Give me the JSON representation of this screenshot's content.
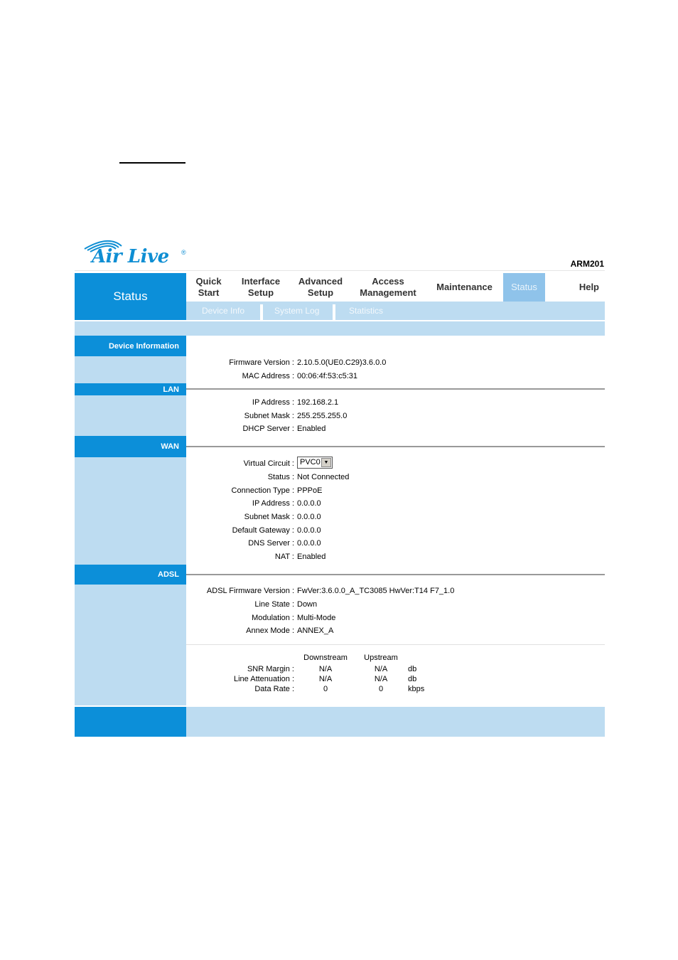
{
  "brand": {
    "logo_text": "Air Live",
    "registered": "®",
    "model": "ARM201",
    "accent": "#0c8fd9",
    "light": "#bddcf1"
  },
  "nav": {
    "section_title": "Status",
    "items": [
      {
        "l1": "Quick",
        "l2": "Start"
      },
      {
        "l1": "Interface",
        "l2": "Setup"
      },
      {
        "l1": "Advanced",
        "l2": "Setup"
      },
      {
        "l1": "Access",
        "l2": "Management"
      },
      {
        "l1": "Maintenance",
        "l2": ""
      },
      {
        "l1": "Status",
        "l2": ""
      },
      {
        "l1": "Help",
        "l2": ""
      }
    ],
    "active": "Status"
  },
  "subnav": [
    "Device Info",
    "System Log",
    "Statistics"
  ],
  "device": {
    "section": "Device Information",
    "firmware_label": "Firmware Version :",
    "firmware": "2.10.5.0(UE0.C29)3.6.0.0",
    "mac_label": "MAC Address :",
    "mac": "00:06:4f:53:c5:31"
  },
  "lan": {
    "section": "LAN",
    "ip_label": "IP Address :",
    "ip": "192.168.2.1",
    "mask_label": "Subnet Mask :",
    "mask": "255.255.255.0",
    "dhcp_label": "DHCP Server :",
    "dhcp": "Enabled"
  },
  "wan": {
    "section": "WAN",
    "vc_label": "Virtual Circuit :",
    "vc": "PVC0",
    "status_label": "Status :",
    "status": "Not Connected",
    "type_label": "Connection Type :",
    "type": "PPPoE",
    "ip_label": "IP Address :",
    "ip": "0.0.0.0",
    "mask_label": "Subnet Mask :",
    "mask": "0.0.0.0",
    "gw_label": "Default Gateway :",
    "gw": "0.0.0.0",
    "dns_label": "DNS Server :",
    "dns": "0.0.0.0",
    "nat_label": "NAT :",
    "nat": "Enabled"
  },
  "adsl": {
    "section": "ADSL",
    "fw_label": "ADSL Firmware Version :",
    "fw": "FwVer:3.6.0.0_A_TC3085 HwVer:T14 F7_1.0",
    "state_label": "Line State :",
    "state": "Down",
    "mod_label": "Modulation :",
    "mod": "Multi-Mode",
    "annex_label": "Annex Mode :",
    "annex": "ANNEX_A",
    "table": {
      "headers": [
        "Downstream",
        "Upstream"
      ],
      "rows": [
        {
          "label": "SNR Margin :",
          "down": "N/A",
          "up": "N/A",
          "unit": "db"
        },
        {
          "label": "Line Attenuation :",
          "down": "N/A",
          "up": "N/A",
          "unit": "db"
        },
        {
          "label": "Data Rate :",
          "down": "0",
          "up": "0",
          "unit": "kbps"
        }
      ]
    }
  }
}
